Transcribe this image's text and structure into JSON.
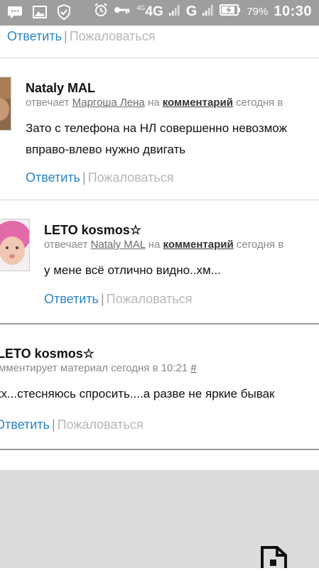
{
  "status_bar": {
    "network_4g_small": "4G",
    "network_4g": "4G",
    "network_g": "G",
    "battery_pct": "79%",
    "time": "10:30"
  },
  "actions": {
    "reply": "Ответить",
    "separator": "|",
    "report": "Пожаловаться"
  },
  "comments": [
    {
      "author": "Nataly MAL",
      "verb": "отвечает",
      "target_user": "Маргоша Лена",
      "on": "на",
      "target_type": "комментарий",
      "time": "сегодня в",
      "lines": [
        "Зато с телефона на НЛ совершенно невозмож",
        "вправо-влево нужно двигать"
      ]
    },
    {
      "author": "LETO kosmos☆",
      "verb": "отвечает",
      "target_user": "Nataly MAL",
      "on": "на",
      "target_type": "комментарий",
      "time": "сегодня в",
      "text": "у мене всё отлично видно..хм..."
    },
    {
      "author": "LETO kosmos☆",
      "meta": "мментирует материал сегодня в 10:21",
      "hash": "#",
      "text": "кх...стесняюсь спросить....а разве не яркие бывак"
    }
  ],
  "colors": {
    "status_bar": "#9e9e9e",
    "link": "#2b84c3",
    "report_link": "#b7b7b7",
    "bottom_area": "#dcdcdc"
  }
}
